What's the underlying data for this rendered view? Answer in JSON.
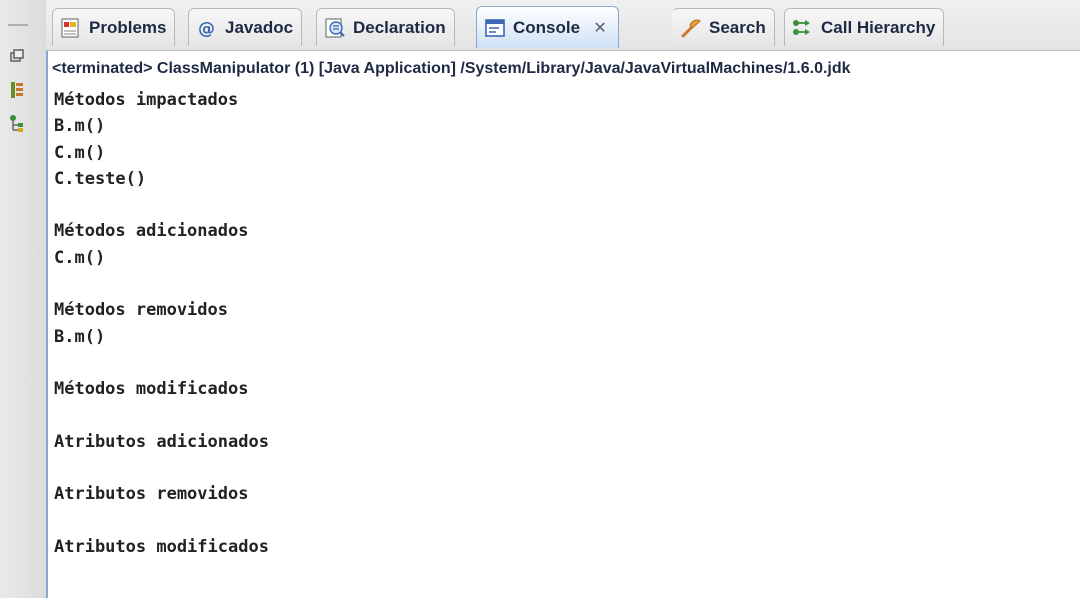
{
  "tabs": [
    {
      "label": "Problems",
      "icon": "problems-icon"
    },
    {
      "label": "Javadoc",
      "icon": "at-icon"
    },
    {
      "label": "Declaration",
      "icon": "declaration-icon"
    },
    {
      "label": "Console",
      "icon": "console-icon",
      "active": true,
      "close": "✕"
    },
    {
      "label": "Search",
      "icon": "search-icon"
    },
    {
      "label": "Call Hierarchy",
      "icon": "call-hierarchy-icon"
    }
  ],
  "console": {
    "header": "<terminated> ClassManipulator (1) [Java Application] /System/Library/Java/JavaVirtualMachines/1.6.0.jdk",
    "lines": [
      "Métodos impactados",
      "B.m()",
      "C.m()",
      "C.teste()",
      "",
      "Métodos adicionados",
      "C.m()",
      "",
      "Métodos removidos",
      "B.m()",
      "",
      "Métodos modificados",
      "",
      "Atributos adicionados",
      "",
      "Atributos removidos",
      "",
      "Atributos modificados"
    ]
  },
  "left_toolbar": {
    "icons": [
      "restore-icon",
      "package-icon",
      "hierarchy-icon"
    ]
  },
  "colors": {
    "accent": "#8aa8cf",
    "text": "#1e2a44"
  }
}
